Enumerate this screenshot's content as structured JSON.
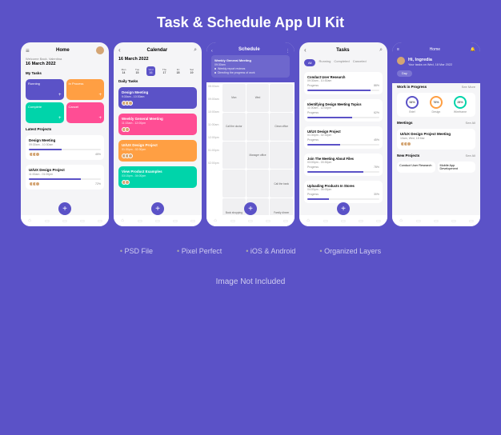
{
  "title": "Task & Schedule App UI Kit",
  "features": [
    "PSD File",
    "Pixel Perfect",
    "iOS & Android",
    "Organized Layers"
  ],
  "footer": "Image Not Included",
  "phone1": {
    "title": "Home",
    "welcome": "Welcome Back, Valentina",
    "date": "16 March 2022",
    "tasks_label": "My Tasks",
    "tiles": [
      {
        "name": "Running"
      },
      {
        "name": "In Process"
      },
      {
        "name": "Complete"
      },
      {
        "name": "Cancel"
      }
    ],
    "projects_label": "Latest Projects",
    "projects": [
      {
        "title": "Design Meeting",
        "time": "09:30am - 10:30am",
        "pct": "45%"
      },
      {
        "title": "UI/UX Design Project",
        "time": "11:00am - 01:00pm",
        "pct": "72%"
      }
    ]
  },
  "phone2": {
    "title": "Calendar",
    "date": "16 March 2022",
    "days": [
      {
        "name": "Mon",
        "num": "14"
      },
      {
        "name": "Tue",
        "num": "15"
      },
      {
        "name": "Wed",
        "num": "16"
      },
      {
        "name": "Thu",
        "num": "17"
      },
      {
        "name": "Fri",
        "num": "18"
      },
      {
        "name": "Sat",
        "num": "19"
      }
    ],
    "daily_label": "Daily Tasks",
    "tasks": [
      {
        "title": "Design Meeting",
        "time": "9:30am - 10:30am",
        "color": "t-blue"
      },
      {
        "title": "Weekly General Meeting",
        "time": "11:15am - 12:00pm",
        "color": "t-pink"
      },
      {
        "title": "UI/UX Design Project",
        "time": "01:30pm - 02:30pm",
        "color": "t-orange"
      },
      {
        "title": "View Product Examples",
        "time": "03:15pm - 04:00pm",
        "color": "t-teal"
      }
    ]
  },
  "phone3": {
    "title": "Schedule",
    "card": {
      "title": "Weekly General Meeting",
      "time": "09:30am",
      "notes": [
        "Weekly report reviews",
        "Directing the progress of work"
      ]
    },
    "hours": [
      "08:00am",
      "09:00am",
      "10:00am",
      "11:00am",
      "12:00pm",
      "01:00pm",
      "02:00pm"
    ],
    "cells": [
      "",
      "Mon",
      "Wed",
      "Call the doctor",
      "",
      "Clean office",
      "",
      "Manager office",
      "",
      "",
      "",
      "Call the bank",
      "Book shopping",
      "",
      "Family dinner"
    ]
  },
  "phone4": {
    "title": "Tasks",
    "tabs": [
      "All",
      "Running",
      "Completed",
      "Canceled"
    ],
    "items": [
      {
        "title": "Conduct User Research",
        "time": "09:30am - 10:30am",
        "pct": "88%"
      },
      {
        "title": "Identifying Design Meeting Topics",
        "time": "11:00am - 12:00pm",
        "pct": "62%"
      },
      {
        "title": "UI/UX Design Project",
        "time": "01:30pm - 02:30pm",
        "pct": "45%"
      },
      {
        "title": "Join The Meeting About Files",
        "time": "03:00pm - 03:30pm",
        "pct": "78%"
      },
      {
        "title": "Uploading Products In Stores",
        "time": "04:00pm - 05:00pm",
        "pct": "30%"
      }
    ]
  },
  "phone5": {
    "title": "Home",
    "greeting": "Hi, Ingredia",
    "tagline": "Your tasks on Wed, 18 Mar 2022",
    "daybtn": "Day",
    "wip_label": "Work in Progress",
    "see_more": "See More",
    "circles": [
      {
        "name": "Brief",
        "pct": "54%"
      },
      {
        "name": "Design",
        "pct": "76%"
      },
      {
        "name": "Wireframe",
        "pct": "28%"
      }
    ],
    "meetings_label": "Meetings",
    "see_all": "See All",
    "meeting": {
      "title": "UI/UX Design Project Meeting",
      "time": "10am, Wed, 18 Mar"
    },
    "np_label": "New Projects",
    "np": [
      {
        "title": "Conduct User Research"
      },
      {
        "title": "Mobile App Development"
      }
    ]
  }
}
